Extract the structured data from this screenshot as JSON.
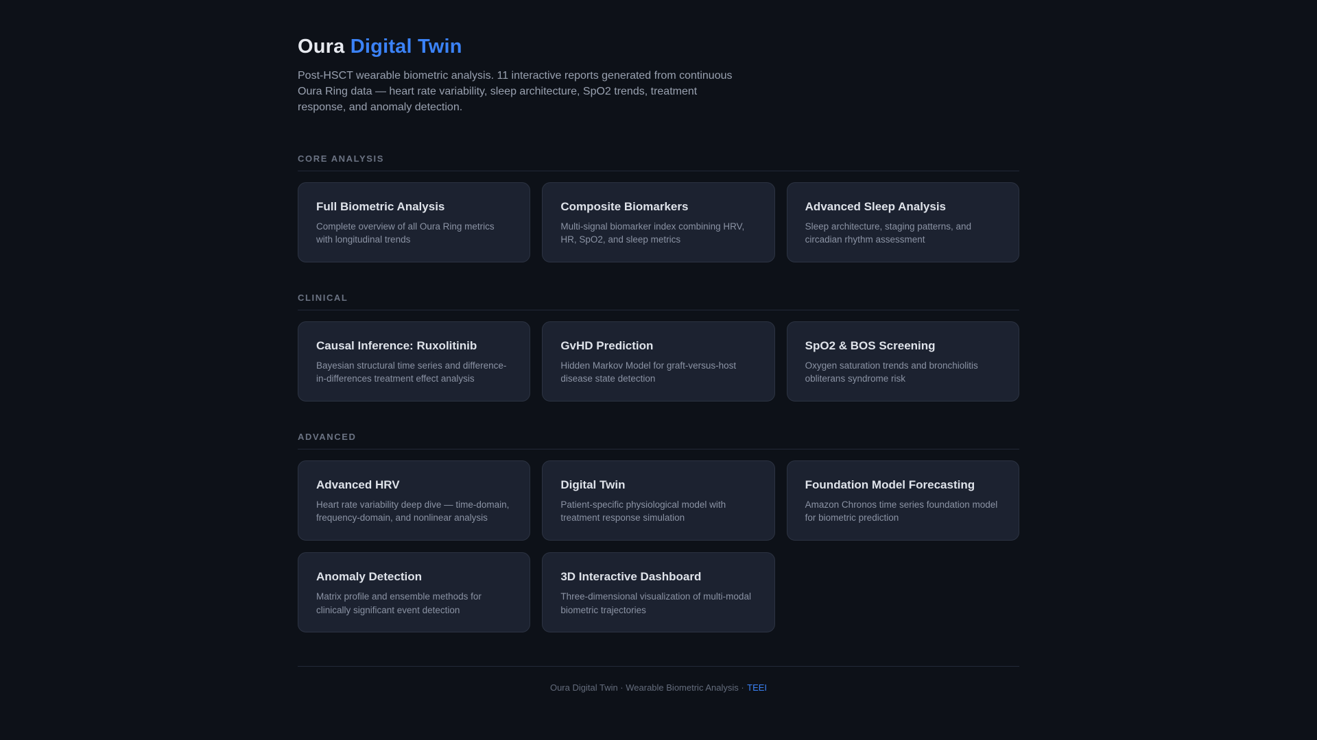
{
  "page": {
    "title_prefix": "Oura ",
    "title_highlight": "Digital Twin",
    "subtitle": "Post-HSCT wearable biometric analysis. 11 interactive reports generated from continuous Oura Ring data — heart rate variability, sleep architecture, SpO2 trends, treatment response, and anomaly detection."
  },
  "sections": [
    {
      "label": "CORE ANALYSIS",
      "cards": [
        {
          "title": "Full Biometric Analysis",
          "description": "Complete overview of all Oura Ring metrics with longitudinal trends"
        },
        {
          "title": "Composite Biomarkers",
          "description": "Multi-signal biomarker index combining HRV, HR, SpO2, and sleep metrics"
        },
        {
          "title": "Advanced Sleep Analysis",
          "description": "Sleep architecture, staging patterns, and circadian rhythm assessment"
        }
      ]
    },
    {
      "label": "CLINICAL",
      "cards": [
        {
          "title": "Causal Inference: Ruxolitinib",
          "description": "Bayesian structural time series and difference-in-differences treatment effect analysis"
        },
        {
          "title": "GvHD Prediction",
          "description": "Hidden Markov Model for graft-versus-host disease state detection"
        },
        {
          "title": "SpO2 & BOS Screening",
          "description": "Oxygen saturation trends and bronchiolitis obliterans syndrome risk"
        }
      ]
    },
    {
      "label": "ADVANCED",
      "cards": [
        {
          "title": "Advanced HRV",
          "description": "Heart rate variability deep dive — time-domain, frequency-domain, and nonlinear analysis"
        },
        {
          "title": "Digital Twin",
          "description": "Patient-specific physiological model with treatment response simulation"
        },
        {
          "title": "Foundation Model Forecasting",
          "description": "Amazon Chronos time series foundation model for biometric prediction"
        },
        {
          "title": "Anomaly Detection",
          "description": "Matrix profile and ensemble methods for clinically significant event detection"
        },
        {
          "title": "3D Interactive Dashboard",
          "description": "Three-dimensional visualization of multi-modal biometric trajectories"
        }
      ]
    }
  ],
  "footer": {
    "text": "Oura Digital Twin · Wearable Biometric Analysis ·",
    "link_label": "TEEI"
  },
  "colors": {
    "accent": "#3b82f6",
    "background": "#0d1118",
    "card_background": "#1c2230",
    "card_border": "#2c3342"
  }
}
